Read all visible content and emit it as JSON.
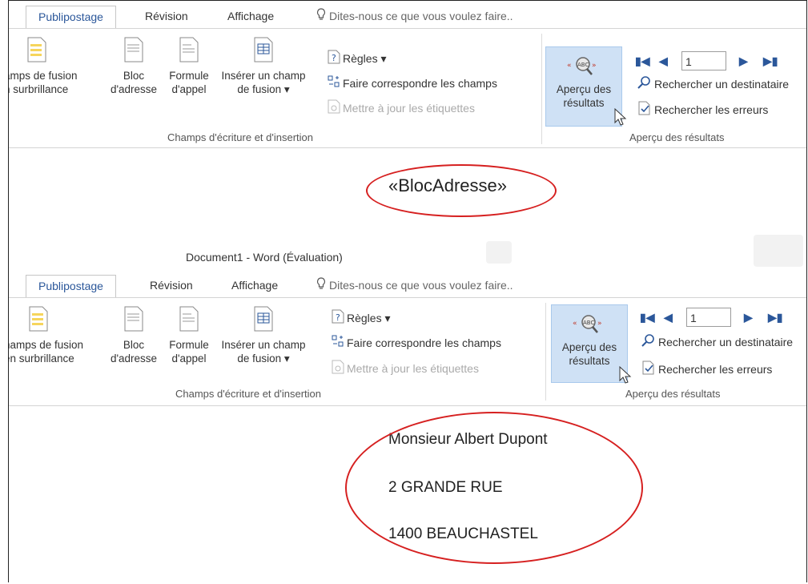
{
  "tabs": [
    "Publipostage",
    "Révision",
    "Affichage"
  ],
  "tell_me": "Dites-nous ce que vous voulez faire..",
  "buttons": {
    "highlight": [
      "amps de fusion",
      "n surbrillance"
    ],
    "highlight2": [
      "hamps de fusion",
      "en surbrillance"
    ],
    "address_block": [
      "Bloc",
      "d'adresse"
    ],
    "greeting": [
      "Formule",
      "d'appel"
    ],
    "insert_field": [
      "Insérer un champ",
      "de fusion ▾"
    ],
    "preview": [
      "Aperçu des",
      "résultats"
    ]
  },
  "small_buttons": {
    "rules": "Règles ▾",
    "match_fields": "Faire correspondre les champs",
    "update_labels": "Mettre à jour les étiquettes",
    "find_recipient": "Rechercher un destinataire",
    "check_errors": "Rechercher les erreurs"
  },
  "groups": {
    "write_insert": "Champs d'écriture et d'insertion",
    "preview_results": "Aperçu des résultats"
  },
  "record_number": "1",
  "window_title": "Document1 - Word (Évaluation)",
  "merge_field": "«BlocAdresse»",
  "address_lines": [
    "Monsieur Albert Dupont",
    "2 GRANDE RUE",
    "1400  BEAUCHASTEL"
  ],
  "colors": {
    "accent": "#2b579a",
    "highlight": "#cfe1f5",
    "annotation": "#d62020"
  }
}
